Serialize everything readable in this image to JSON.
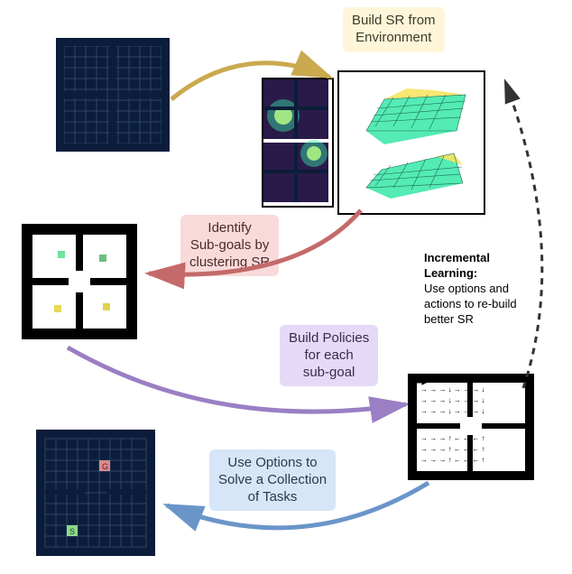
{
  "labels": {
    "build_sr": "Build SR from\nEnvironment",
    "identify": "Identify\nSub-goals by\nclustering SR",
    "build_policies": "Build Policies\nfor each\nsub-goal",
    "use_options": "Use Options to\nSolve a Collection\nof Tasks",
    "incremental_title": "Incremental\nLearning:",
    "incremental_body": "Use options and\nactions to re-build\nbetter SR"
  },
  "markers": {
    "goal": "G",
    "start": "S"
  },
  "colors": {
    "yellow": "#f9eec0",
    "pink": "#f5c9c9",
    "purple": "#d8c9ef",
    "blue": "#c9daf2",
    "grid_dark": "#0b1d3a",
    "grid_line": "#2d4566",
    "sub1": "#6fe39a",
    "sub2": "#6abf7f",
    "sub3": "#e8d95a",
    "sub4": "#e0d24a",
    "plot_bg": "#2a1a4a",
    "plot_accent": "#36e8a8",
    "plot_peak": "#f7e463"
  }
}
